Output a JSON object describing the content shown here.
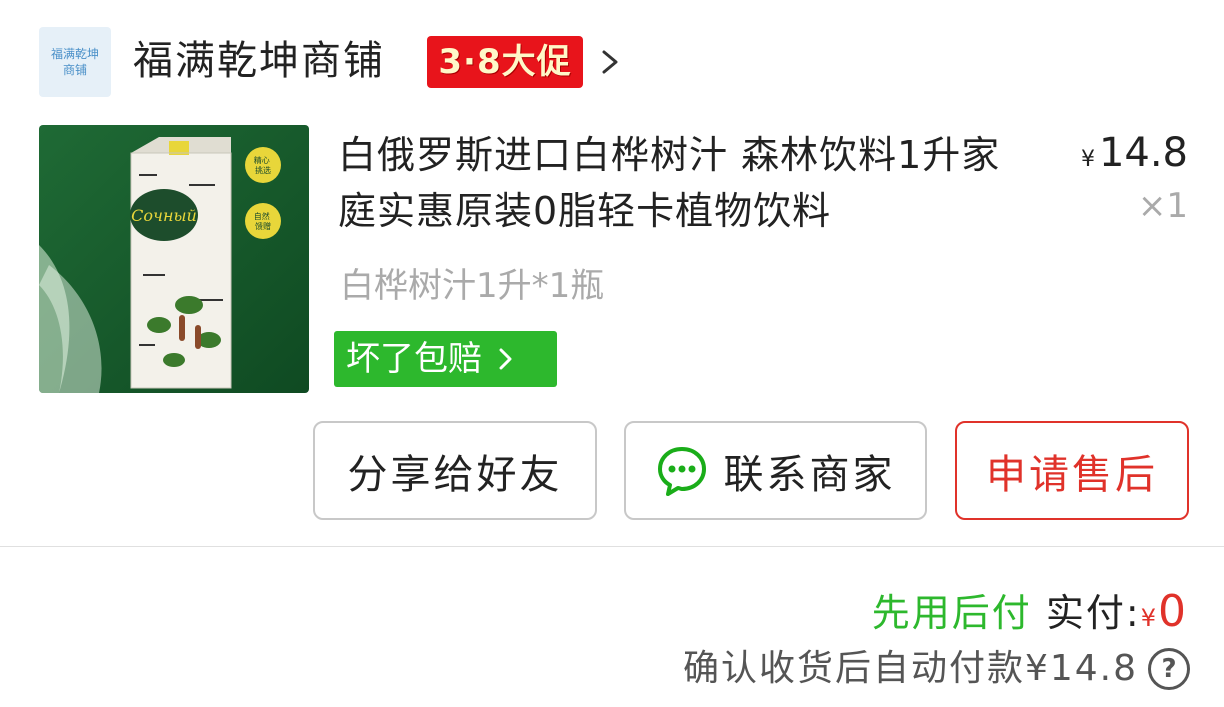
{
  "shop": {
    "logo_line1": "福满乾坤",
    "logo_line2": "商铺",
    "name": "福满乾坤商铺",
    "promo_badge": "3·8大促"
  },
  "product": {
    "title": "白俄罗斯进口白桦树汁 森林饮料1升家庭实惠原装0脂轻卡植物饮料",
    "price_symbol": "¥",
    "price": "14.8",
    "quantity": "×1",
    "variant": "白桦树汁1升*1瓶",
    "guarantee": "坏了包赔",
    "image": {
      "brand": "Сочный",
      "tag1_line1": "精心",
      "tag1_line2": "挑选",
      "tag2_line1": "自然",
      "tag2_line2": "馈赠"
    }
  },
  "actions": {
    "share": "分享给好友",
    "contact": "联系商家",
    "after_sale": "申请售后"
  },
  "payment": {
    "pay_later": "先用后付",
    "paid_label": "实付:",
    "paid_symbol": "¥",
    "paid_amount": "0",
    "auto_pay": "确认收货后自动付款¥14.8",
    "help": "?"
  },
  "colors": {
    "green": "#2db82d",
    "red": "#e0322a",
    "promo_red": "#e8141b"
  }
}
